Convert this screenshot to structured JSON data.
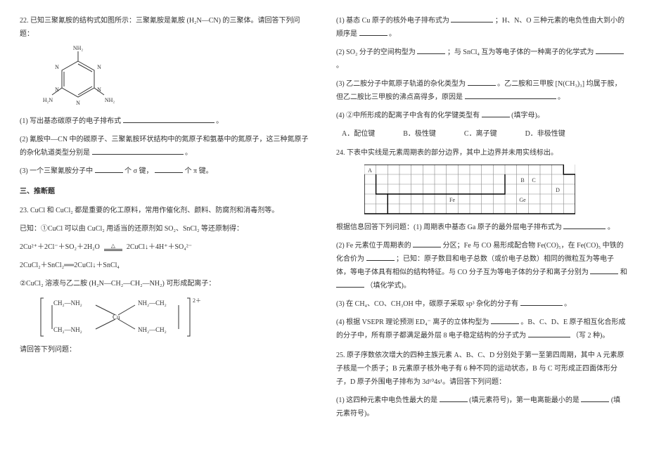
{
  "left": {
    "q22": {
      "stem": "22. 已知三聚氰胺的结构式如图所示：三聚氰胺是氰胺 (H₂N—CN) 的三聚体。请回答下列问题：",
      "mol": {
        "nh2": "NH₂",
        "n": "N",
        "h2n": "H₂N"
      },
      "p1": "(1) 写出基态碳原子的电子排布式",
      "p1tail": "。",
      "p2": "(2) 氰胺中—CN 中的碳原子、三聚氰胺环状结构中的氮原子和氨基中的氮原子，这三种氮原子的杂化轨道类型分别是",
      "p2tail": "。",
      "p3a": "(3) 一个三聚氰胺分子中",
      "p3b": "个 σ 键，",
      "p3c": "个 π 键。"
    },
    "section3": "三、推断题",
    "q23": {
      "stem": "23. CuCl 和 CuCl₂ 都是重要的化工原料，常用作催化剂、颜料、防腐剂和消毒剂等。",
      "given": "已知：①CuCl 可以由 CuCl₂ 用适当的还原剂如 SO₂、SnCl₂ 等还原制得：",
      "eq1a": "2Cu²⁺＋2Cl⁻＋SO₂＋2H₂O",
      "eq1mid": "△",
      "eq1b": "2CuCl↓＋4H⁺＋SO₄²⁻",
      "eq2": "2CuCl₂＋SnCl₂══2CuCl↓＋SnCl₄",
      "c2": "②CuCl₂ 溶液与乙二胺 (H₂N—CH₂—CH₂—NH₂) 可形成配离子：",
      "complex": {
        "ch2nh2top": "CH₂—NH₂",
        "nh2ch2top": "NH₂—CH₂",
        "ch2nh2bot": "CH₂—NH₂",
        "nh2ch2bot": "NH₂—CH₂",
        "cu": "Cu",
        "charge": "2＋"
      },
      "ask": "请回答下列问题："
    }
  },
  "right": {
    "p1a": "(1) 基态 Cu 原子的核外电子排布式为",
    "p1b": "；H、N、O 三种元素的电负性由大到小的顺序是",
    "p1c": "。",
    "p2a": "(2) SO₂ 分子的空间构型为",
    "p2b": "；与 SnCl₄ 互为等电子体的一种离子的化学式为",
    "p2c": "。",
    "p3a": "(3) 乙二胺分子中氮原子轨道的杂化类型为",
    "p3b": "。乙二胺和三甲胺 [N(CH₃)₃] 均属于胺，但乙二胺比三甲胺的沸点高得多，原因是",
    "p3c": "。",
    "p4a": "(4) ②中所形成的配离子中含有的化学键类型有",
    "p4b": "(填字母)。",
    "opts": {
      "a": "A．配位键",
      "b": "B．极性键",
      "c": "C．离子键",
      "d": "D．非极性键"
    },
    "q24": {
      "stem": "24. 下表中实线是元素周期表的部分边界，其中上边界并未用实线标出。",
      "grid": {
        "A": "A",
        "B": "B",
        "C": "C",
        "D": "D",
        "Fe": "Fe",
        "Ge": "Ge"
      },
      "p1a": "根据信息回答下列问题：(1) 周期表中基态 Ga 原子的最外层电子排布式为",
      "p1b": "。",
      "p2a": "(2) Fe 元素位于周期表的",
      "p2b": "分区；Fe 与 CO 易形成配合物 Fe(CO)₅，在 Fe(CO)₅ 中铁的化合价为",
      "p2c": "；已知：原子数目和电子总数（或价电子总数）相同的微粒互为等电子体，等电子体具有相似的结构特征。与 CO 分子互为等电子体的分子和离子分别为",
      "p2d": "和",
      "p2e": "（填化学式)。",
      "p3a": "(3) 在 CH₄、CO、CH₃OH 中，碳原子采取 sp³ 杂化的分子有",
      "p3b": "。",
      "p4a": "(4) 根据 VSEPR 理论预测 ED₄⁻ 离子的立体构型为",
      "p4b": "。B、C、D、E 原子相互化合形成的分子中，所有原子都满足最外层 8 电子稳定结构的分子式为",
      "p4c": "（写 2 种)。"
    },
    "q25": {
      "stem": "25. 原子序数依次增大的四种主族元素 A、B、C、D 分别处于第一至第四周期，其中 A 元素原子核是一个质子；B 元素原子核外电子有 6 种不同的运动状态，B 与 C 可形成正四面体形分子，D 原子外围电子排布为 3d¹⁰4s¹。请回答下列问题：",
      "p1a": "(1) 这四种元素中电负性最大的是",
      "p1b": "(填元素符号)，第一电离能最小的是",
      "p1c": "(填元素符号)。"
    }
  }
}
